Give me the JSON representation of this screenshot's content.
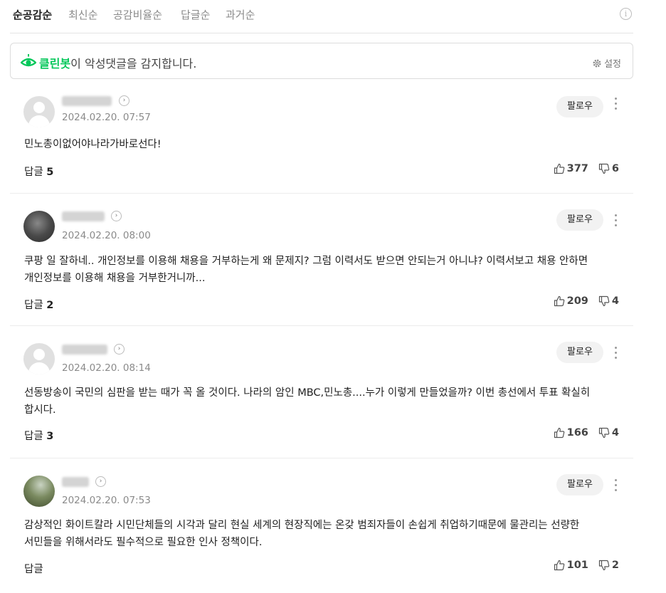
{
  "sort_tabs": [
    {
      "label": "순공감순",
      "active": true
    },
    {
      "label": "최신순",
      "active": false
    },
    {
      "label": "공감비율순",
      "active": false
    },
    {
      "label": "답글순",
      "active": false
    },
    {
      "label": "과거순",
      "active": false
    }
  ],
  "info_icon": "i",
  "cleanbot": {
    "brand": "클린봇",
    "message": "이 악성댓글을 감지합니다.",
    "settings_label": "설정",
    "brand_color": "#03c75a"
  },
  "comments": [
    {
      "date": "2024.02.20. 07:57",
      "follow_label": "팔로우",
      "text": "민노총이없어야나라가바로선다!",
      "reply_label": "답글",
      "reply_count": "5",
      "likes": "377",
      "dislikes": "6",
      "avatar": "default"
    },
    {
      "date": "2024.02.20. 08:00",
      "follow_label": "팔로우",
      "text": "쿠팡 일 잘하네.. 개인정보를 이용해 채용을 거부하는게 왜 문제지? 그럼 이력서도 받으면 안되는거 아니냐? 이력서보고 채용 안하면 개인정보를 이용해 채용을 거부한거니까...",
      "reply_label": "답글",
      "reply_count": "2",
      "likes": "209",
      "dislikes": "4",
      "avatar": "dark"
    },
    {
      "date": "2024.02.20. 08:14",
      "follow_label": "팔로우",
      "text": "선동방송이 국민의 심판을 받는 때가 꼭 올 것이다. 나라의 암인 MBC,민노총....누가 이렇게 만들었을까? 이번 총선에서 투표 확실히 합시다.",
      "reply_label": "답글",
      "reply_count": "3",
      "likes": "166",
      "dislikes": "4",
      "avatar": "default"
    },
    {
      "date": "2024.02.20. 07:53",
      "follow_label": "팔로우",
      "text": "감상적인 화이트칼라 시민단체들의 시각과 달리 현실 세계의 현장직에는 온갖 범죄자들이 손쉽게 취업하기때문에 물관리는 선량한 서민들을 위해서라도 필수적으로 필요한 인사 정책이다.",
      "reply_label": "답글",
      "reply_count": "",
      "likes": "101",
      "dislikes": "2",
      "avatar": "scene"
    }
  ]
}
